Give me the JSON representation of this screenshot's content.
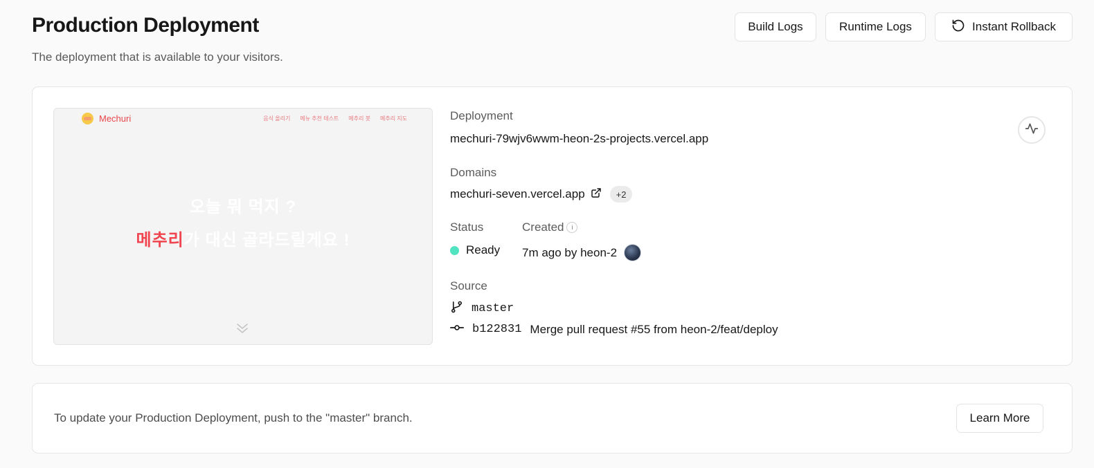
{
  "header": {
    "title": "Production Deployment",
    "subtitle": "The deployment that is available to your visitors."
  },
  "actions": {
    "build_logs": "Build Logs",
    "runtime_logs": "Runtime Logs",
    "instant_rollback": "Instant Rollback"
  },
  "preview": {
    "brand": "Mechuri",
    "nav": [
      "음식 올리기",
      "메뉴 추천 테스트",
      "메추리 봇",
      "메추리 지도"
    ],
    "headline_1": "오늘 뭐 먹지 ?",
    "headline_2_highlight": "메추리",
    "headline_2_rest": "가 대신 골라드릴게요 !"
  },
  "deployment": {
    "label": "Deployment",
    "url": "mechuri-79wjv6wwm-heon-2s-projects.vercel.app"
  },
  "domains": {
    "label": "Domains",
    "primary": "mechuri-seven.vercel.app",
    "extra_count": "+2"
  },
  "status": {
    "label": "Status",
    "value": "Ready",
    "color": "#50e3c2"
  },
  "created": {
    "label": "Created",
    "info": "i",
    "value": "7m ago by heon-2"
  },
  "source": {
    "label": "Source",
    "branch": "master",
    "commit_hash": "b122831",
    "commit_message": "Merge pull request #55 from heon-2/feat/deploy"
  },
  "footer_card": {
    "text": "To update your Production Deployment, push to the \"master\" branch.",
    "learn_more": "Learn More"
  },
  "icons": {
    "rollback": "rotate-ccw-icon",
    "external": "external-link-icon",
    "branch": "git-branch-icon",
    "commit": "git-commit-icon",
    "activity": "activity-icon"
  }
}
